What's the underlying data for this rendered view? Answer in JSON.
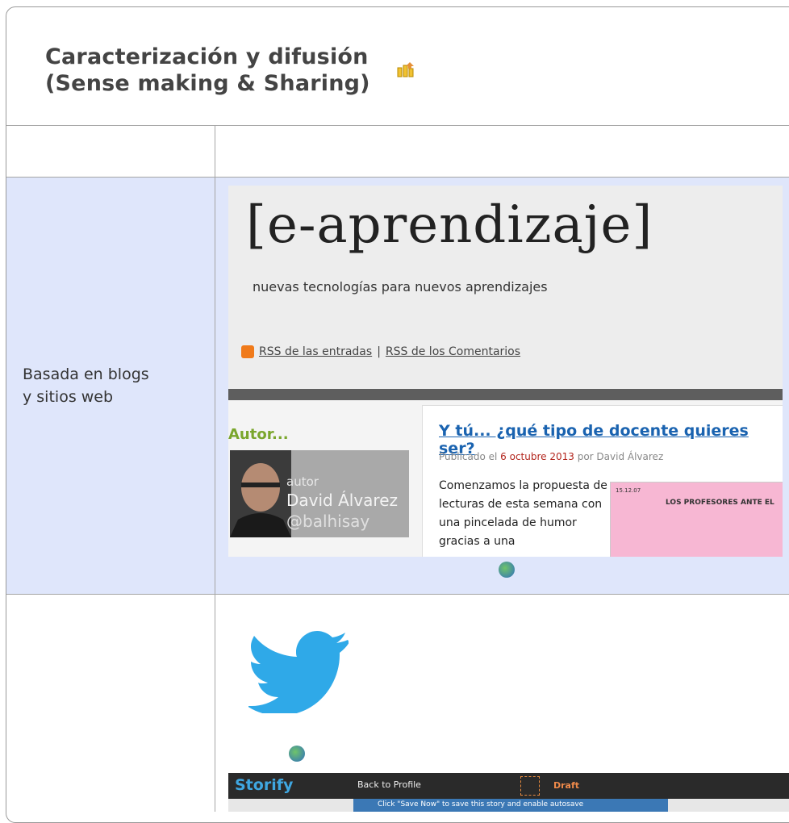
{
  "header": {
    "title_line1": "Caracterización y difusión",
    "title_line2": "(Sense making & Sharing)"
  },
  "row_blog": {
    "label_line1": "Basada en blogs",
    "label_line2": "y sitios web"
  },
  "blog_screenshot": {
    "logo": "[e-aprendizaje]",
    "tagline": "nuevas tecnologías para nuevos aprendizajes",
    "rss_entries": "RSS de las entradas",
    "separator": " | ",
    "rss_comments": "RSS de los Comentarios",
    "autor_heading": "Autor...",
    "autor_role": "autor",
    "autor_name": "David Álvarez",
    "autor_handle": "@balhisay",
    "post_title": "Y tú... ¿qué tipo de docente quieres ser?",
    "post_meta_prefix": "Publicado el ",
    "post_date": "6 octubre 2013",
    "post_meta_suffix": " por David Álvarez",
    "post_excerpt": "Comenzamos la propuesta de lecturas de esta semana con una pincelada de humor gracias a una",
    "comic_caption": "LOS PROFESORES ANTE EL",
    "comic_date": "15.12.07"
  },
  "storify_screenshot": {
    "logo": "Storify",
    "back": "Back to Profile",
    "draft": "Draft",
    "notice": "Click \"Save Now\" to save this story and enable autosave"
  },
  "colors": {
    "accent_blue": "#dfe6fb",
    "link_blue": "#1a63b0",
    "twitter_blue": "#2fa9e8"
  }
}
